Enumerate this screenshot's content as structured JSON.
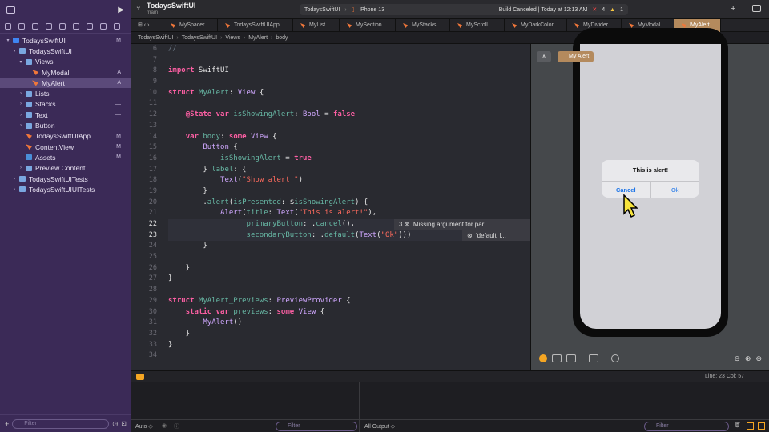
{
  "project": {
    "name": "TodaysSwiftUI",
    "branch": "main"
  },
  "toolbar": {
    "scheme": "TodaysSwiftUI",
    "device": "iPhone 13",
    "status": "Build Canceled | Today at 12:13 AM",
    "errors": "4",
    "warnings": "1"
  },
  "tabs": [
    "MySpacer",
    "TodaysSwiftUIApp",
    "MyList",
    "MySection",
    "MyStacks",
    "MyScroll",
    "MyDarkColor",
    "MyDivider",
    "MyModal",
    "MyAlert"
  ],
  "breadcrumbs": [
    "TodaysSwiftUI",
    "TodaysSwiftUI",
    "Views",
    "MyAlert",
    "body"
  ],
  "navigator": [
    {
      "label": "TodaysSwiftUI",
      "badge": "M",
      "kind": "proj",
      "chev": "▾",
      "sel": false
    },
    {
      "label": "TodaysSwiftUI",
      "badge": "",
      "kind": "folder",
      "chev": "▾",
      "sel": false
    },
    {
      "label": "Views",
      "badge": "",
      "kind": "folder",
      "chev": "▾",
      "sel": false
    },
    {
      "label": "MyModal",
      "badge": "A",
      "kind": "swift",
      "chev": "",
      "sel": false
    },
    {
      "label": "MyAlert",
      "badge": "A",
      "kind": "swift",
      "chev": "",
      "sel": true
    },
    {
      "label": "Lists",
      "badge": "—",
      "kind": "folder",
      "chev": "›",
      "sel": false
    },
    {
      "label": "Stacks",
      "badge": "—",
      "kind": "folder",
      "chev": "›",
      "sel": false
    },
    {
      "label": "Text",
      "badge": "—",
      "kind": "folder",
      "chev": "›",
      "sel": false
    },
    {
      "label": "Button",
      "badge": "—",
      "kind": "folder",
      "chev": "›",
      "sel": false
    },
    {
      "label": "TodaysSwiftUIApp",
      "badge": "M",
      "kind": "swift",
      "chev": "",
      "sel": false
    },
    {
      "label": "ContentView",
      "badge": "M",
      "kind": "swift",
      "chev": "",
      "sel": false
    },
    {
      "label": "Assets",
      "badge": "M",
      "kind": "asset",
      "chev": "",
      "sel": false
    },
    {
      "label": "Preview Content",
      "badge": "",
      "kind": "folder",
      "chev": "›",
      "sel": false
    },
    {
      "label": "TodaysSwiftUITests",
      "badge": "",
      "kind": "folder",
      "chev": "›",
      "sel": false
    },
    {
      "label": "TodaysSwiftUIUITests",
      "badge": "",
      "kind": "folder",
      "chev": "›",
      "sel": false
    }
  ],
  "sidebar_filter": "Filter",
  "code_lines": [
    {
      "n": "6",
      "html": "<span class='cm'>//</span>"
    },
    {
      "n": "7",
      "html": ""
    },
    {
      "n": "8",
      "html": "<span class='kw'>import</span> SwiftUI"
    },
    {
      "n": "9",
      "html": ""
    },
    {
      "n": "10",
      "html": "<span class='kw'>struct</span> <span class='pr'>MyAlert</span>: <span class='ty'>View</span> {"
    },
    {
      "n": "11",
      "html": ""
    },
    {
      "n": "12",
      "html": "    <span class='kw'>@State</span> <span class='kw'>var</span> <span class='pr'>isShowingAlert</span>: <span class='ty'>Bool</span> = <span class='kw'>false</span>"
    },
    {
      "n": "13",
      "html": ""
    },
    {
      "n": "14",
      "html": "    <span class='kw'>var</span> <span class='pr'>body</span>: <span class='kw'>some</span> <span class='ty'>View</span> {"
    },
    {
      "n": "15",
      "html": "        <span class='ty'>Button</span> {"
    },
    {
      "n": "16",
      "html": "            <span class='pr'>isShowingAlert</span> = <span class='kw'>true</span>"
    },
    {
      "n": "17",
      "html": "        } <span class='pr'>label</span>: {"
    },
    {
      "n": "18",
      "html": "            <span class='ty'>Text</span>(<span class='st'>\"Show alert!\"</span>)"
    },
    {
      "n": "19",
      "html": "        }"
    },
    {
      "n": "20",
      "html": "        .<span class='pr'>alert</span>(<span class='pr'>isPresented</span>: $<span class='pr'>isShowingAlert</span>) {"
    },
    {
      "n": "21",
      "html": "            <span class='ty'>Alert</span>(<span class='pr'>title</span>: <span class='ty'>Text</span>(<span class='st'>\"This is alert!\"</span>),"
    },
    {
      "n": "22",
      "html": "                  <span class='pr'>primaryButton</span>: .<span class='pr'>cancel</span>(),"
    },
    {
      "n": "23",
      "html": "                  <span class='pr'>secondaryButton</span>: .<span class='pr'>default</span>(<span class='ty'>Text</span>(<span class='st'>\"Ok\"</span>)))"
    },
    {
      "n": "24",
      "html": "        }"
    },
    {
      "n": "25",
      "html": ""
    },
    {
      "n": "26",
      "html": "    }"
    },
    {
      "n": "27",
      "html": "}"
    },
    {
      "n": "28",
      "html": ""
    },
    {
      "n": "29",
      "html": "<span class='kw'>struct</span> <span class='pr'>MyAlert_Previews</span>: <span class='ty'>PreviewProvider</span> {"
    },
    {
      "n": "30",
      "html": "    <span class='kw'>static</span> <span class='kw'>var</span> <span class='pr'>previews</span>: <span class='kw'>some</span> <span class='ty'>View</span> {"
    },
    {
      "n": "31",
      "html": "        <span class='ty'>MyAlert</span>()"
    },
    {
      "n": "32",
      "html": "    }"
    },
    {
      "n": "33",
      "html": "}"
    },
    {
      "n": "34",
      "html": ""
    }
  ],
  "annotations": {
    "line22": "3 ⊗  Missing argument for par...",
    "line23": "⊗  'default' l..."
  },
  "preview": {
    "chip": "My Alert",
    "alert_title": "This is alert!",
    "cancel": "Cancel",
    "ok": "Ok"
  },
  "status": {
    "position": "Line: 23  Col: 57"
  },
  "console": {
    "mode": "Auto ◇",
    "filter": "Filter",
    "output": "All Output ◇",
    "filter_right": "Filter"
  }
}
